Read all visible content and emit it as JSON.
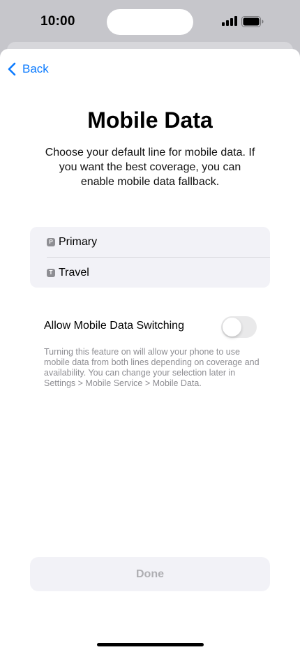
{
  "status_bar": {
    "time": "10:00",
    "signal_icon": "cellular-signal-icon",
    "battery_icon": "battery-full-icon"
  },
  "nav": {
    "back_label": "Back",
    "back_icon": "chevron-left-icon",
    "accent_color": "#0a7aff"
  },
  "header": {
    "title": "Mobile Data",
    "subtitle": "Choose your default line for mobile data. If you want the best coverage, you can enable mobile data fallback."
  },
  "lines": [
    {
      "badge": "P",
      "label": "Primary"
    },
    {
      "badge": "T",
      "label": "Travel"
    }
  ],
  "switching": {
    "label": "Allow Mobile Data Switching",
    "enabled": false,
    "footnote": "Turning this feature on will allow your phone to use mobile data from both lines depending on coverage and availability. You can change your selection later in Settings > Mobile Service > Mobile Data."
  },
  "footer": {
    "done_label": "Done",
    "done_enabled": false
  }
}
